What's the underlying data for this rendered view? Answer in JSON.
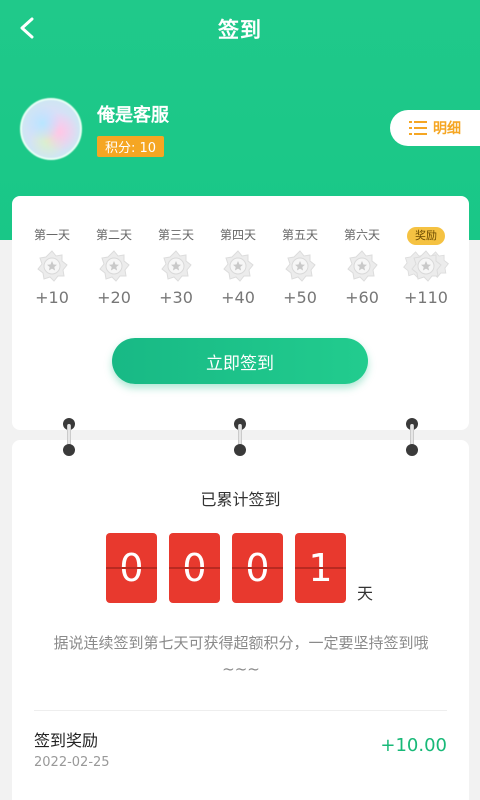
{
  "header": {
    "title": "签到"
  },
  "user": {
    "name": "俺是客服",
    "points_label": "积分: 10"
  },
  "detail_button": {
    "label": "明细"
  },
  "days": [
    {
      "label": "第一天",
      "points": "+10",
      "is_reward": false
    },
    {
      "label": "第二天",
      "points": "+20",
      "is_reward": false
    },
    {
      "label": "第三天",
      "points": "+30",
      "is_reward": false
    },
    {
      "label": "第四天",
      "points": "+40",
      "is_reward": false
    },
    {
      "label": "第五天",
      "points": "+50",
      "is_reward": false
    },
    {
      "label": "第六天",
      "points": "+60",
      "is_reward": false
    },
    {
      "label": "奖励",
      "points": "+110",
      "is_reward": true
    }
  ],
  "sign_button": {
    "label": "立即签到"
  },
  "accumulated": {
    "title": "已累计签到",
    "digits": [
      "0",
      "0",
      "0",
      "1"
    ],
    "unit": "天",
    "tip": "据说连续签到第七天可获得超额积分，一定要坚持签到哦~~~"
  },
  "records": [
    {
      "title": "签到奖励",
      "date": "2022-02-25",
      "amount": "+10.00"
    }
  ],
  "colors": {
    "primary": "#1fc88a",
    "badge": "#f5a623",
    "digit_bg": "#e8392e",
    "amount": "#18b978"
  }
}
